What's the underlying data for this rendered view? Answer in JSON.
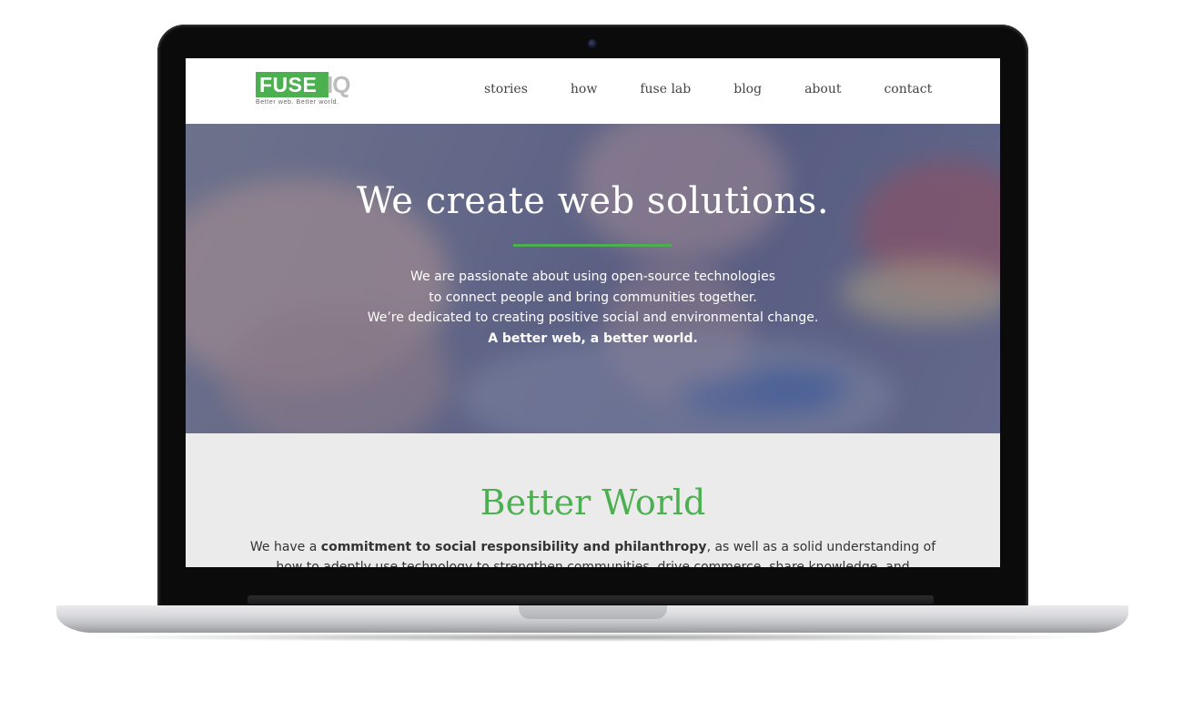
{
  "header": {
    "logo": {
      "primary": "FUSE",
      "secondary": "IQ",
      "tagline": "Better web. Better world."
    },
    "nav": [
      {
        "label": "stories"
      },
      {
        "label": "how"
      },
      {
        "label": "fuse lab"
      },
      {
        "label": "blog"
      },
      {
        "label": "about"
      },
      {
        "label": "contact"
      }
    ]
  },
  "hero": {
    "title": "We create web solutions.",
    "lines": [
      "We are passionate about using open-source technologies",
      "to connect people and bring communities together.",
      "We’re dedicated to creating positive social and environmental change."
    ],
    "emphasis": "A better web, a better world."
  },
  "better_world": {
    "title": "Better World",
    "text_prefix": "We have a ",
    "text_bold": "commitment to social responsibility and philanthropy",
    "text_suffix": ", as well as a solid understanding of",
    "text_line2": "how to adeptly use technology to strengthen communities, drive commerce, share knowledge, and"
  },
  "colors": {
    "accent_green": "#4caf50",
    "hero_tint": "#6b7090",
    "section_bg": "#ebebeb"
  }
}
